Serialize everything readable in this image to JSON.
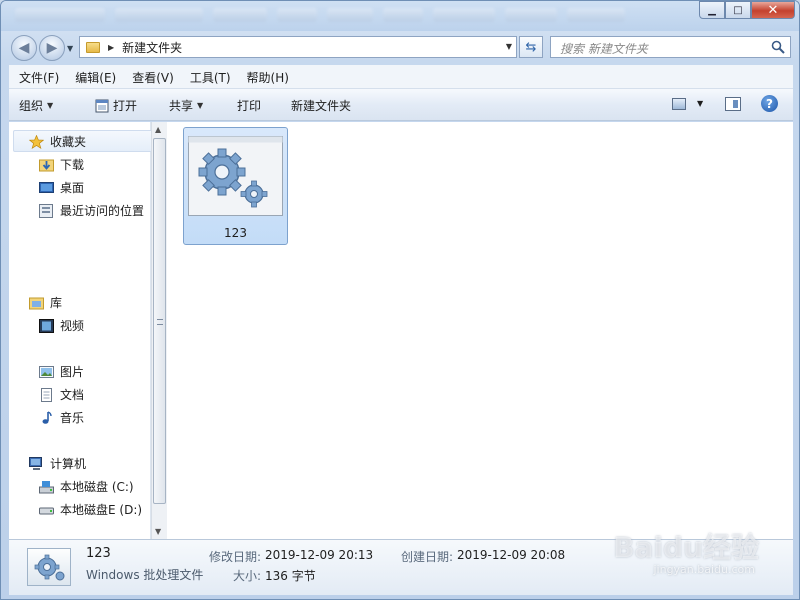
{
  "window": {
    "caption_min": "▁",
    "caption_max": "□",
    "caption_close": "✕"
  },
  "address": {
    "path": "新建文件夹",
    "search_placeholder": "搜索 新建文件夹"
  },
  "menu": {
    "file": "文件(F)",
    "edit": "编辑(E)",
    "view": "查看(V)",
    "tools": "工具(T)",
    "help": "帮助(H)"
  },
  "toolbar": {
    "organize": "组织",
    "open": "打开",
    "share": "共享",
    "print": "打印",
    "new_folder": "新建文件夹",
    "help": "?"
  },
  "nav": {
    "favorites": "收藏夹",
    "downloads": "下载",
    "desktop": "桌面",
    "recent": "最近访问的位置",
    "libraries": "库",
    "videos": "视频",
    "pictures": "图片",
    "documents": "文档",
    "music": "音乐",
    "computer": "计算机",
    "drive_c": "本地磁盘 (C:)",
    "drive_d": "本地磁盘E (D:)"
  },
  "files": [
    {
      "name": "123",
      "icon": "batch-file-gear-icon",
      "selected": true
    }
  ],
  "details": {
    "name": "123",
    "type": "Windows 批处理文件",
    "modified_label": "修改日期:",
    "modified_value": "2019-12-09 20:13",
    "created_label": "创建日期:",
    "created_value": "2019-12-09 20:08",
    "size_label": "大小:",
    "size_value": "136 字节"
  },
  "watermark": {
    "main": "Baidu经验",
    "sub": "jingyan.baidu.com"
  }
}
